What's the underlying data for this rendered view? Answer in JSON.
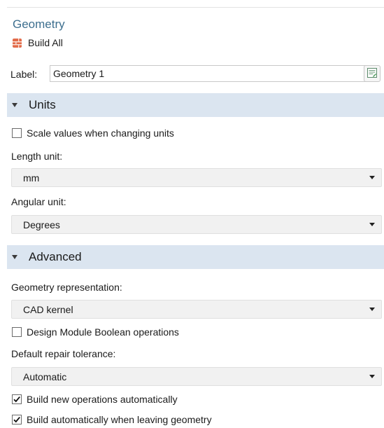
{
  "header": {
    "title": "Geometry",
    "build_all_label": "Build All"
  },
  "label_field": {
    "label": "Label:",
    "value": "Geometry 1"
  },
  "units": {
    "title": "Units",
    "scale_checkbox": {
      "label": "Scale values when changing units",
      "checked": false
    },
    "length_unit": {
      "label": "Length unit:",
      "value": "mm"
    },
    "angular_unit": {
      "label": "Angular unit:",
      "value": "Degrees"
    }
  },
  "advanced": {
    "title": "Advanced",
    "geometry_representation": {
      "label": "Geometry representation:",
      "value": "CAD kernel"
    },
    "design_module_checkbox": {
      "label": "Design Module Boolean operations",
      "checked": false
    },
    "repair_tolerance": {
      "label": "Default repair tolerance:",
      "value": "Automatic"
    },
    "build_new_ops_checkbox": {
      "label": "Build new operations automatically",
      "checked": true
    },
    "build_leaving_checkbox": {
      "label": "Build automatically when leaving geometry",
      "checked": true
    }
  },
  "colors": {
    "title_blue": "#3d6f8f",
    "section_bg": "#dbe5f0",
    "build_icon": "#d9534f"
  },
  "icons": {
    "build_all": "build-all-icon",
    "edit": "label-edit-icon",
    "collapse": "triangle-down-icon",
    "dropdown": "chevron-down-icon"
  }
}
